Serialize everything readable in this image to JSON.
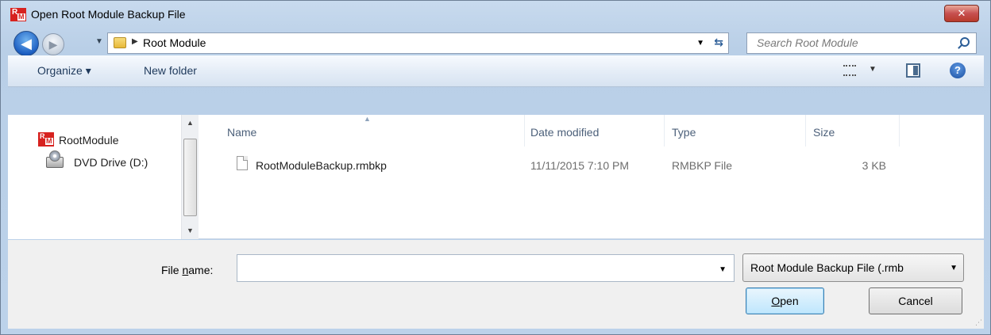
{
  "window": {
    "title": "Open Root Module Backup File",
    "logo_r": "R",
    "logo_m": "M",
    "close_glyph": "✕"
  },
  "nav": {
    "back_glyph": "◀",
    "forward_glyph": "▶",
    "breadcrumb": [
      "Root Module"
    ],
    "search_placeholder": "Search Root Module"
  },
  "toolbar": {
    "organize_label": "Organize ▾",
    "new_folder_label": "New folder"
  },
  "sidebar": {
    "items": [
      {
        "label": "RootModule",
        "icon": "rootmodule-logo-icon"
      },
      {
        "label": "DVD Drive (D:)",
        "icon": "dvd-drive-icon"
      }
    ]
  },
  "files": {
    "columns": [
      "Name",
      "Date modified",
      "Type",
      "Size"
    ],
    "rows": [
      {
        "name": "RootModuleBackup.rmbkp",
        "date": "11/11/2015 7:10 PM",
        "type": "RMBKP File",
        "size": "3 KB"
      }
    ]
  },
  "footer": {
    "file_name_label_pre": "File ",
    "file_name_label_u": "n",
    "file_name_label_post": "ame:",
    "file_name_value": "",
    "filter_selected": "Root Module Backup File (.rmb",
    "open_label_u": "O",
    "open_label_rest": "pen",
    "cancel_label": "Cancel"
  },
  "colors": {
    "accent": "#1d5fc2",
    "brand_red": "#d7221f"
  }
}
